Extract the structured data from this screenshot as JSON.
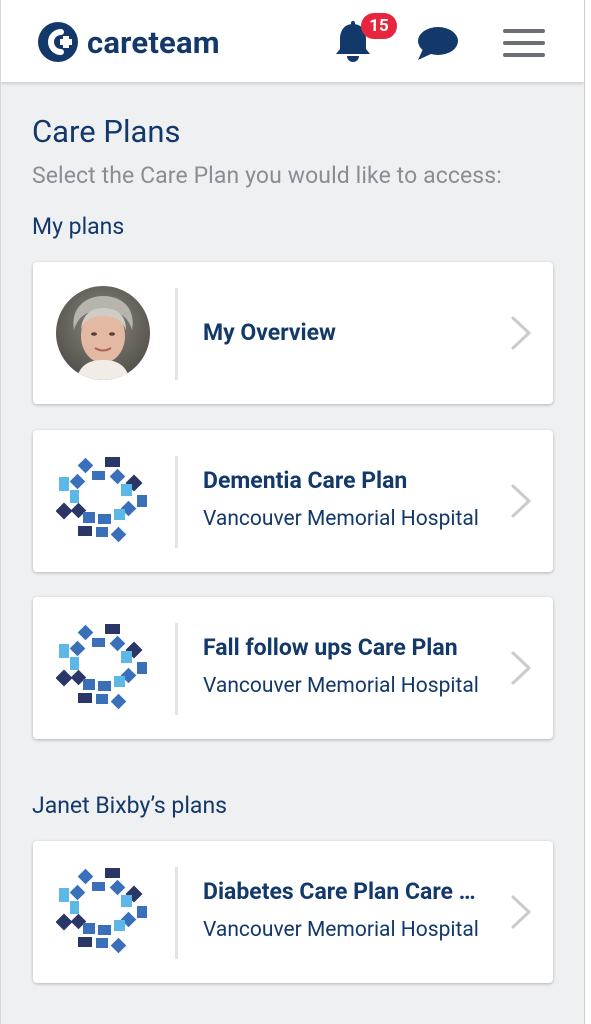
{
  "header": {
    "app_name": "careteam",
    "notification_count": "15",
    "icons": [
      "careteam-logo-icon",
      "bell-icon",
      "chat-icon",
      "hamburger-menu-icon"
    ]
  },
  "page": {
    "title": "Care Plans",
    "subtitle": "Select the Care Plan you would like to access:"
  },
  "sections": [
    {
      "title": "My plans",
      "cards": [
        {
          "title": "My Overview",
          "subtitle": "",
          "icon": "user-avatar"
        },
        {
          "title": "Dementia Care Plan",
          "subtitle": "Vancouver Memorial Hospital",
          "icon": "care-plan-pattern-icon"
        },
        {
          "title": "Fall follow ups Care Plan",
          "subtitle": "Vancouver Memorial Hospital",
          "icon": "care-plan-pattern-icon"
        }
      ]
    },
    {
      "title": "Janet Bixby’s plans",
      "cards": [
        {
          "title": "Diabetes Care Plan Care …",
          "subtitle": "Vancouver Memorial Hospital",
          "icon": "care-plan-pattern-icon"
        }
      ]
    }
  ],
  "colors": {
    "brand": "#13386a",
    "badge": "#e8253f",
    "background": "#eff0f2",
    "pattern_dark": "#2a3666",
    "pattern_mid": "#3a6fba",
    "pattern_light": "#5cb8e6"
  }
}
